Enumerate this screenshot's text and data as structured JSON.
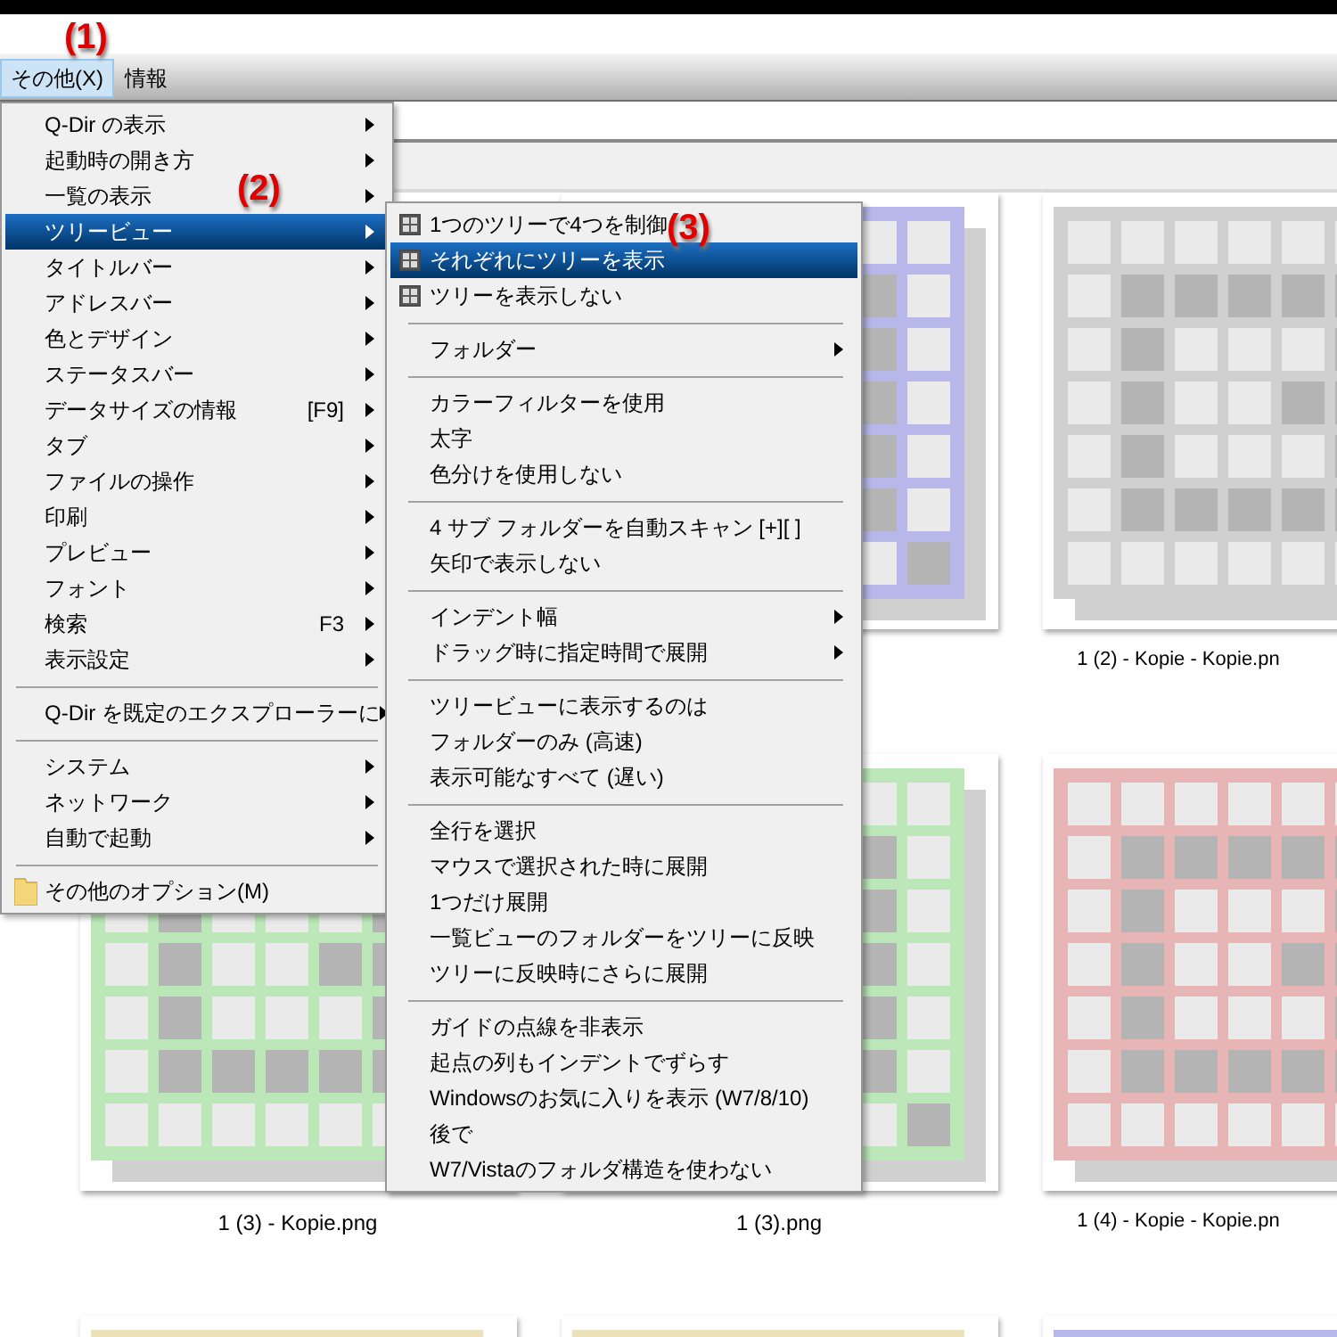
{
  "annotations": [
    "(1)",
    "(2)",
    "(3)"
  ],
  "menubar": [
    {
      "label": "その他(X)",
      "selected": true
    },
    {
      "label": "情報",
      "selected": false
    }
  ],
  "menu": [
    {
      "kind": "item",
      "label": "Q-Dir の表示",
      "submenu": true,
      "selected": false
    },
    {
      "kind": "item",
      "label": "起動時の開き方",
      "submenu": true,
      "selected": false
    },
    {
      "kind": "item",
      "label": "一覧の表示",
      "submenu": true,
      "selected": false
    },
    {
      "kind": "item",
      "label": "ツリービュー",
      "submenu": true,
      "selected": true
    },
    {
      "kind": "item",
      "label": "タイトルバー",
      "submenu": true,
      "selected": false
    },
    {
      "kind": "item",
      "label": "アドレスバー",
      "submenu": true,
      "selected": false
    },
    {
      "kind": "item",
      "label": "色とデザイン",
      "submenu": true,
      "selected": false
    },
    {
      "kind": "item",
      "label": "ステータスバー",
      "submenu": true,
      "selected": false
    },
    {
      "kind": "item",
      "label": "データサイズの情報",
      "shortcut": "[F9]",
      "submenu": true,
      "selected": false
    },
    {
      "kind": "item",
      "label": "タブ",
      "submenu": true,
      "selected": false
    },
    {
      "kind": "item",
      "label": "ファイルの操作",
      "submenu": true,
      "selected": false
    },
    {
      "kind": "item",
      "label": "印刷",
      "submenu": true,
      "selected": false
    },
    {
      "kind": "item",
      "label": "プレビュー",
      "submenu": true,
      "selected": false
    },
    {
      "kind": "item",
      "label": "フォント",
      "submenu": true,
      "selected": false
    },
    {
      "kind": "item",
      "label": "検索",
      "shortcut": "F3",
      "submenu": true,
      "selected": false
    },
    {
      "kind": "item",
      "label": "表示設定",
      "submenu": true,
      "selected": false
    },
    {
      "kind": "separator"
    },
    {
      "kind": "item",
      "label": "Q-Dir を既定のエクスプローラーに",
      "submenu": true,
      "selected": false
    },
    {
      "kind": "separator"
    },
    {
      "kind": "item",
      "label": "システム",
      "submenu": true,
      "selected": false
    },
    {
      "kind": "item",
      "label": "ネットワーク",
      "submenu": true,
      "selected": false
    },
    {
      "kind": "item",
      "label": "自動で起動",
      "submenu": true,
      "selected": false
    },
    {
      "kind": "separator"
    },
    {
      "kind": "folder",
      "label": "その他のオプション(M)",
      "submenu": false,
      "selected": false
    }
  ],
  "submenu": [
    {
      "kind": "icon",
      "label": "1つのツリーで4つを制御",
      "submenu": false,
      "selected": false
    },
    {
      "kind": "icon",
      "label": "それぞれにツリーを表示",
      "submenu": false,
      "selected": true
    },
    {
      "kind": "icon",
      "label": "ツリーを表示しない",
      "submenu": false,
      "selected": false
    },
    {
      "kind": "separator"
    },
    {
      "kind": "item",
      "label": "フォルダー",
      "submenu": true,
      "selected": false
    },
    {
      "kind": "separator"
    },
    {
      "kind": "item",
      "label": "カラーフィルターを使用",
      "submenu": false,
      "selected": false
    },
    {
      "kind": "item",
      "label": "太字",
      "submenu": false,
      "selected": false
    },
    {
      "kind": "item",
      "label": "色分けを使用しない",
      "submenu": false,
      "selected": false
    },
    {
      "kind": "separator"
    },
    {
      "kind": "item",
      "label": "4 サブ フォルダーを自動スキャン [+][ ]",
      "submenu": false,
      "selected": false
    },
    {
      "kind": "item",
      "label": "矢印で表示しない",
      "submenu": false,
      "selected": false
    },
    {
      "kind": "separator"
    },
    {
      "kind": "item",
      "label": "インデント幅",
      "submenu": true,
      "selected": false
    },
    {
      "kind": "item",
      "label": "ドラッグ時に指定時間で展開",
      "submenu": true,
      "selected": false
    },
    {
      "kind": "separator"
    },
    {
      "kind": "item",
      "label": "ツリービューに表示するのは",
      "submenu": false,
      "selected": false
    },
    {
      "kind": "item",
      "label": "フォルダーのみ (高速)",
      "submenu": false,
      "selected": false
    },
    {
      "kind": "item",
      "label": "表示可能なすべて (遅い)",
      "submenu": false,
      "selected": false
    },
    {
      "kind": "separator"
    },
    {
      "kind": "item",
      "label": "全行を選択",
      "submenu": false,
      "selected": false
    },
    {
      "kind": "item",
      "label": "マウスで選択された時に展開",
      "submenu": false,
      "selected": false
    },
    {
      "kind": "item",
      "label": "1つだけ展開",
      "submenu": false,
      "selected": false
    },
    {
      "kind": "item",
      "label": "一覧ビューのフォルダーをツリーに反映",
      "submenu": false,
      "selected": false
    },
    {
      "kind": "item",
      "label": "ツリーに反映時にさらに展開",
      "submenu": false,
      "selected": false
    },
    {
      "kind": "separator"
    },
    {
      "kind": "item",
      "label": "ガイドの点線を非表示",
      "submenu": false,
      "selected": false
    },
    {
      "kind": "item",
      "label": "起点の列もインデントでずらす",
      "submenu": false,
      "selected": false
    },
    {
      "kind": "item",
      "label": "Windowsのお気に入りを表示 (W7/8/10)",
      "submenu": false,
      "selected": false
    },
    {
      "kind": "item",
      "label": "後で",
      "submenu": false,
      "selected": false
    },
    {
      "kind": "item",
      "label": "W7/Vistaのフォルダ構造を使わない",
      "submenu": false,
      "selected": false
    }
  ],
  "thumbnails": [
    {
      "color": "#b7b7e9"
    },
    {
      "color": "#d0d0d0",
      "label": "1 (2) - Kopie - Kopie.pn"
    },
    {
      "color": "#bbe7b9",
      "label": "1 (3) - Kopie.png"
    },
    {
      "color": "#bbe7b9",
      "label": "1 (3).png"
    },
    {
      "color": "#e7b5b5",
      "label": "1 (4) - Kopie - Kopie.pn"
    },
    {
      "color": "#ebe2b9"
    },
    {
      "color": "#ebe2b9"
    },
    {
      "color": "#b7b7e9"
    }
  ]
}
